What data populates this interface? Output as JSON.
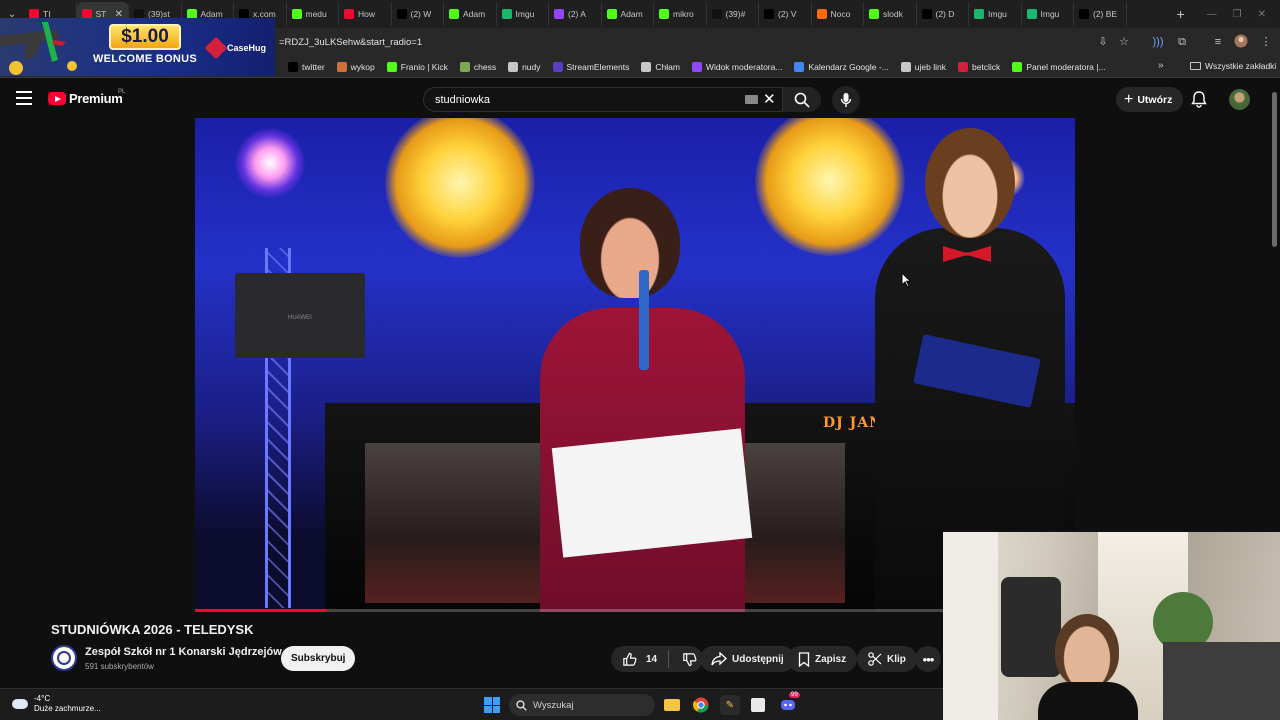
{
  "browser": {
    "tabs": [
      {
        "label": "TI",
        "favicon": "youtube-icon",
        "color": "#ff0033"
      },
      {
        "label": "ST",
        "favicon": "youtube-icon",
        "color": "#ff0033",
        "active": true
      },
      {
        "label": "(39)st",
        "favicon": "tiktok-icon",
        "color": "#111111"
      },
      {
        "label": "Adam",
        "favicon": "kick-icon",
        "color": "#53fc18"
      },
      {
        "label": "x.com",
        "favicon": "x-icon",
        "color": "#000000"
      },
      {
        "label": "medu",
        "favicon": "kick-icon",
        "color": "#53fc18"
      },
      {
        "label": "How",
        "favicon": "youtube-icon",
        "color": "#ff0033"
      },
      {
        "label": "(2) W",
        "favicon": "x-icon",
        "color": "#000000"
      },
      {
        "label": "Adam",
        "favicon": "kick-icon",
        "color": "#53fc18"
      },
      {
        "label": "Imgu",
        "favicon": "imgur-icon",
        "color": "#1bb76e"
      },
      {
        "label": "(2) A",
        "favicon": "twitch-icon",
        "color": "#9146ff"
      },
      {
        "label": "Adam",
        "favicon": "kick-icon",
        "color": "#53fc18"
      },
      {
        "label": "mikro",
        "favicon": "kick-icon",
        "color": "#53fc18"
      },
      {
        "label": "(39)#",
        "favicon": "tiktok-icon",
        "color": "#111111"
      },
      {
        "label": "(2) V",
        "favicon": "x-icon",
        "color": "#000000"
      },
      {
        "label": "Noco",
        "favicon": "a-icon",
        "color": "#ff6a00"
      },
      {
        "label": "slodk",
        "favicon": "kick-icon",
        "color": "#53fc18"
      },
      {
        "label": "(2) D",
        "favicon": "x-icon",
        "color": "#000000"
      },
      {
        "label": "Imgu",
        "favicon": "imgur-icon",
        "color": "#1bb76e"
      },
      {
        "label": "Imgu",
        "favicon": "imgur-icon",
        "color": "#1bb76e"
      },
      {
        "label": "(2) BE",
        "favicon": "x-icon",
        "color": "#000000"
      }
    ],
    "address": "=RDZJ_3uLKSehw&start_radio=1",
    "bookmarks": [
      {
        "label": "twitter",
        "icon": "x-icon",
        "color": "#000000"
      },
      {
        "label": "wykop",
        "icon": "wykop-icon",
        "color": "#cf6f3a"
      },
      {
        "label": "Franio | Kick",
        "icon": "kick-icon",
        "color": "#53fc18"
      },
      {
        "label": "chess",
        "icon": "chess-icon",
        "color": "#7fa650"
      },
      {
        "label": "nudy",
        "icon": "folder-icon",
        "color": "#c4c7c5"
      },
      {
        "label": "StreamElements",
        "icon": "streamelements-icon",
        "color": "#5b3cc4"
      },
      {
        "label": "Chłam",
        "icon": "globe-icon",
        "color": "#c4c7c5"
      },
      {
        "label": "Widok moderatora...",
        "icon": "twitch-icon",
        "color": "#9146ff"
      },
      {
        "label": "Kalendarz Google -...",
        "icon": "calendar-icon",
        "color": "#4285f4"
      },
      {
        "label": "ujeb link",
        "icon": "globe-icon",
        "color": "#c4c7c5"
      },
      {
        "label": "betclick",
        "icon": "betclick-icon",
        "color": "#d2213d"
      },
      {
        "label": "Panel moderatora |...",
        "icon": "kick-icon",
        "color": "#53fc18"
      }
    ],
    "all_bookmarks": "Wszystkie zakładki"
  },
  "ad": {
    "amount": "$1.00",
    "text": "WELCOME BONUS",
    "brand": "CaseHug"
  },
  "youtube": {
    "brand": "Premium",
    "region": "PL",
    "search_query": "studniowka",
    "create_label": "Utwórz",
    "video_overlay_text": "DJ JANUSZ",
    "laptop_text": "HUAWEI",
    "progress_fraction": 0.15,
    "title": "STUDNIÓWKA 2026 - TELEDYSK",
    "channel_name": "Zespół Szkół nr 1 Konarski Jędrzejów",
    "subscribers": "591 subskrybentów",
    "subscribe_label": "Subskrybuj",
    "likes": "14",
    "share_label": "Udostępnij",
    "save_label": "Zapisz",
    "clip_label": "Klip"
  },
  "taskbar": {
    "temperature": "-4°C",
    "weather": "Duże zachmurze...",
    "search_placeholder": "Wyszukaj",
    "discord_badge": "99"
  },
  "colors": {
    "accent": "#ff0033",
    "background": "#0f0f0f",
    "pill": "#272727"
  }
}
